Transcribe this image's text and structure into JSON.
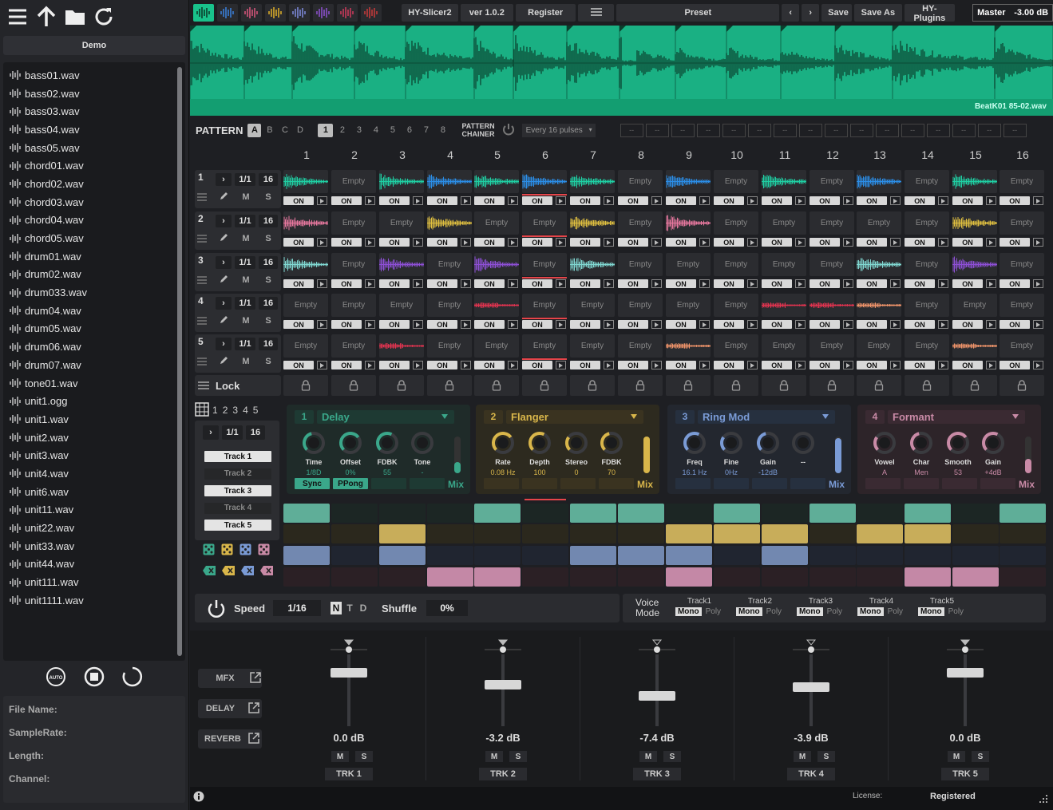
{
  "sidebar": {
    "demo_label": "Demo",
    "files": [
      "bass01.wav",
      "bass02.wav",
      "bass03.wav",
      "bass04.wav",
      "bass05.wav",
      "chord01.wav",
      "chord02.wav",
      "chord03.wav",
      "chord04.wav",
      "chord05.wav",
      "drum01.wav",
      "drum02.wav",
      "drum033.wav",
      "drum04.wav",
      "drum05.wav",
      "drum06.wav",
      "drum07.wav",
      "tone01.wav",
      "unit1.ogg",
      "unit1.wav",
      "unit2.wav",
      "unit3.wav",
      "unit4.wav",
      "unit6.wav",
      "unit11.wav",
      "unit22.wav",
      "unit33.wav",
      "unit44.wav",
      "unit111.wav",
      "unit1111.wav"
    ],
    "auto_label": "AUTO",
    "info": {
      "file_name": "File Name:",
      "sample_rate": "SampleRate:",
      "length": "Length:",
      "channel": "Channel:"
    }
  },
  "topbar": {
    "track_colors": [
      "#19c28b",
      "#3a7dd6",
      "#d2547a",
      "#d6a92a",
      "#7a86d6",
      "#8a4fc9",
      "#c73a5a",
      "#c33a3a"
    ],
    "app_name": "HY-Slicer2",
    "version": "ver 1.0.2",
    "register": "Register",
    "preset": "Preset",
    "save": "Save",
    "save_as": "Save As",
    "plugins": "HY-Plugins",
    "master_label": "Master",
    "master_value": "-3.00 dB"
  },
  "waveform": {
    "filename": "BeatK01 85-02.wav",
    "color": "#16a777"
  },
  "pattern": {
    "label": "PATTERN",
    "letters": [
      "A",
      "B",
      "C",
      "D"
    ],
    "active_letter": "A",
    "numbers": [
      "1",
      "2",
      "3",
      "4",
      "5",
      "6",
      "7",
      "8"
    ],
    "active_number": "1",
    "chainer_label_1": "PATTERN",
    "chainer_label_2": "CHAINER",
    "chainer_mode": "Every 16 pulses",
    "chain_slots": [
      "--",
      "--",
      "--",
      "--",
      "--",
      "--",
      "--",
      "--",
      "--",
      "--",
      "--",
      "--",
      "--",
      "--",
      "--",
      "--"
    ]
  },
  "columns": [
    "1",
    "2",
    "3",
    "4",
    "5",
    "6",
    "7",
    "8",
    "9",
    "10",
    "11",
    "12",
    "13",
    "14",
    "15",
    "16"
  ],
  "tracks": [
    {
      "num": "1",
      "div": "1/1",
      "steps": "16",
      "m": "M",
      "s": "S",
      "color": "#1fc9a0",
      "cells": [
        "w",
        "Empty",
        "w",
        "wb",
        "w",
        "wb",
        "w",
        "Empty",
        "wb",
        "Empty",
        "w",
        "Empty",
        "wb",
        "Empty",
        "w",
        "Empty"
      ]
    },
    {
      "num": "2",
      "div": "1/1",
      "steps": "16",
      "m": "M",
      "s": "S",
      "color": "#e87aa6",
      "cells": [
        "wp",
        "Empty",
        "Empty",
        "wy",
        "Empty",
        "Empty",
        "wy",
        "Empty",
        "wp",
        "Empty",
        "Empty",
        "Empty",
        "Empty",
        "Empty",
        "wy",
        "Empty"
      ]
    },
    {
      "num": "3",
      "div": "1/1",
      "steps": "16",
      "m": "M",
      "s": "S",
      "color": "#7fd6d6",
      "cells": [
        "wc",
        "Empty",
        "wv",
        "Empty",
        "wv",
        "Empty",
        "wc",
        "Empty",
        "Empty",
        "Empty",
        "Empty",
        "Empty",
        "wc",
        "Empty",
        "wv",
        "Empty"
      ]
    },
    {
      "num": "4",
      "div": "1/1",
      "steps": "16",
      "m": "M",
      "s": "S",
      "color": "#e0405a",
      "cells": [
        "Empty",
        "Empty",
        "Empty",
        "Empty",
        "wr",
        "Empty",
        "Empty",
        "Empty",
        "Empty",
        "Empty",
        "wr",
        "wr",
        "wo",
        "Empty",
        "Empty",
        "Empty"
      ]
    },
    {
      "num": "5",
      "div": "1/1",
      "steps": "16",
      "m": "M",
      "s": "S",
      "color": "#e0405a",
      "cells": [
        "Empty",
        "Empty",
        "wr",
        "Empty",
        "Empty",
        "Empty",
        "Empty",
        "Empty",
        "wo",
        "Empty",
        "Empty",
        "Empty",
        "Empty",
        "Empty",
        "wo",
        "Empty"
      ]
    }
  ],
  "on_label": "ON",
  "empty_label": "Empty",
  "lock_label": "Lock",
  "fxleft": {
    "nums": [
      "1",
      "2",
      "3",
      "4",
      "5"
    ],
    "div": "1/1",
    "steps": "16",
    "tracks": [
      "Track 1",
      "Track 2",
      "Track 3",
      "Track 4",
      "Track 5"
    ]
  },
  "fx": [
    {
      "num": "1",
      "name": "Delay",
      "theme": "#3aa78a",
      "knobs": [
        {
          "label": "Time",
          "value": "1/8D"
        },
        {
          "label": "Offset",
          "value": "0%"
        },
        {
          "label": "FDBK",
          "value": "55"
        },
        {
          "label": "Tone",
          "value": "-"
        }
      ],
      "buttons": [
        "Sync",
        "PPong",
        "",
        ""
      ],
      "mix": "Mix"
    },
    {
      "num": "2",
      "name": "Flanger",
      "theme": "#d9b64a",
      "knobs": [
        {
          "label": "Rate",
          "value": "0.08 Hz"
        },
        {
          "label": "Depth",
          "value": "100"
        },
        {
          "label": "Stereo",
          "value": "0"
        },
        {
          "label": "FDBK",
          "value": "70"
        }
      ],
      "buttons": [
        "",
        "",
        "",
        ""
      ],
      "mix": "Mix"
    },
    {
      "num": "3",
      "name": "Ring Mod",
      "theme": "#7a9bd6",
      "knobs": [
        {
          "label": "Freq",
          "value": "16.1 Hz"
        },
        {
          "label": "Fine",
          "value": "0Hz"
        },
        {
          "label": "Gain",
          "value": "-12dB"
        },
        {
          "label": "--",
          "value": ""
        }
      ],
      "buttons": [
        "",
        "",
        "",
        ""
      ],
      "mix": "Mix"
    },
    {
      "num": "4",
      "name": "Formant",
      "theme": "#c98aa6",
      "knobs": [
        {
          "label": "Vowel",
          "value": "A"
        },
        {
          "label": "Char",
          "value": "Men"
        },
        {
          "label": "Smooth",
          "value": "53"
        },
        {
          "label": "Gain",
          "value": "+4dB"
        }
      ],
      "buttons": [
        "",
        "",
        "",
        ""
      ],
      "mix": "Mix"
    }
  ],
  "seq": [
    [
      1,
      0,
      0,
      0,
      1,
      0,
      1,
      1,
      0,
      1,
      0,
      1,
      0,
      1,
      0,
      1
    ],
    [
      0,
      0,
      1,
      0,
      0,
      0,
      0,
      0,
      1,
      1,
      1,
      0,
      1,
      1,
      0,
      0
    ],
    [
      1,
      0,
      1,
      0,
      0,
      0,
      1,
      1,
      1,
      0,
      1,
      0,
      0,
      0,
      0,
      0
    ],
    [
      0,
      0,
      0,
      1,
      1,
      0,
      0,
      0,
      1,
      0,
      0,
      0,
      0,
      1,
      1,
      0
    ]
  ],
  "speedbar": {
    "speed_label": "Speed",
    "speed": "1/16",
    "modes": [
      "N",
      "T",
      "D"
    ],
    "shuffle_label": "Shuffle",
    "shuffle": "0%"
  },
  "voice": {
    "label1": "Voice",
    "label2": "Mode",
    "tracks": [
      "Track1",
      "Track2",
      "Track3",
      "Track4",
      "Track5"
    ],
    "mono": "Mono",
    "poly": "Poly"
  },
  "mixer": {
    "sends": [
      "MFX",
      "DELAY",
      "REVERB"
    ],
    "channels": [
      {
        "db": "0.0 dB",
        "name": "TRK 1",
        "m": "M",
        "s": "S",
        "level": 0.75
      },
      {
        "db": "-3.2 dB",
        "name": "TRK 2",
        "m": "M",
        "s": "S",
        "level": 0.58
      },
      {
        "db": "-7.4 dB",
        "name": "TRK 3",
        "m": "M",
        "s": "S",
        "level": 0.42
      },
      {
        "db": "-3.9 dB",
        "name": "TRK 4",
        "m": "M",
        "s": "S",
        "level": 0.55
      },
      {
        "db": "0.0 dB",
        "name": "TRK 5",
        "m": "M",
        "s": "S",
        "level": 0.75
      }
    ]
  },
  "status": {
    "license_label": "License:",
    "license_value": "Registered"
  }
}
